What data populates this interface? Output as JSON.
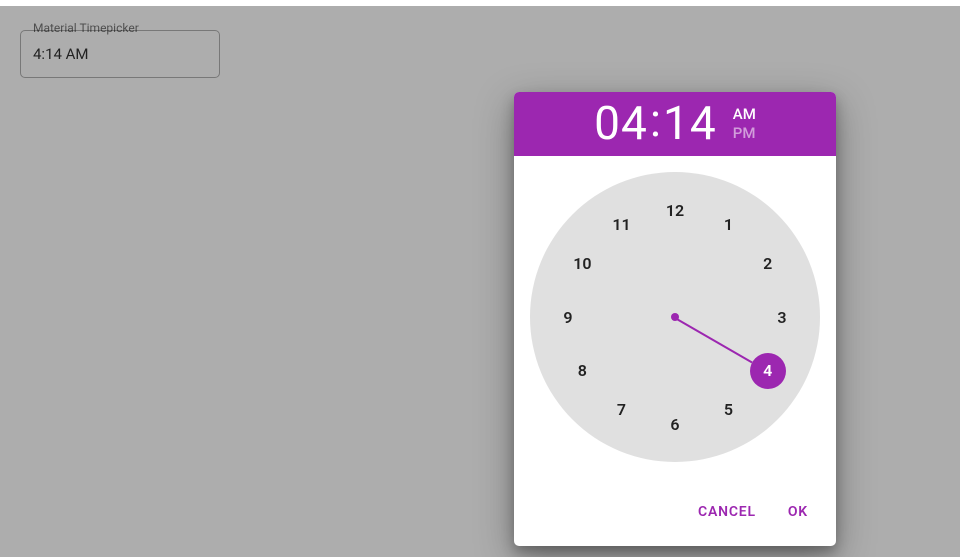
{
  "input": {
    "label": "Material Timepicker",
    "value": "4:14 AM"
  },
  "dialog": {
    "header": {
      "hour": "04",
      "separator": ":",
      "minute": "14",
      "am_label": "AM",
      "pm_label": "PM",
      "active_period": "AM"
    },
    "clock": {
      "hours": [
        "12",
        "1",
        "2",
        "3",
        "4",
        "5",
        "6",
        "7",
        "8",
        "9",
        "10",
        "11"
      ],
      "selected_hour": "4"
    },
    "actions": {
      "cancel": "CANCEL",
      "ok": "OK"
    }
  },
  "colors": {
    "primary": "#9c27b0",
    "clock_face": "#e0e0e0",
    "backdrop": "rgba(0,0,0,0.32)"
  }
}
